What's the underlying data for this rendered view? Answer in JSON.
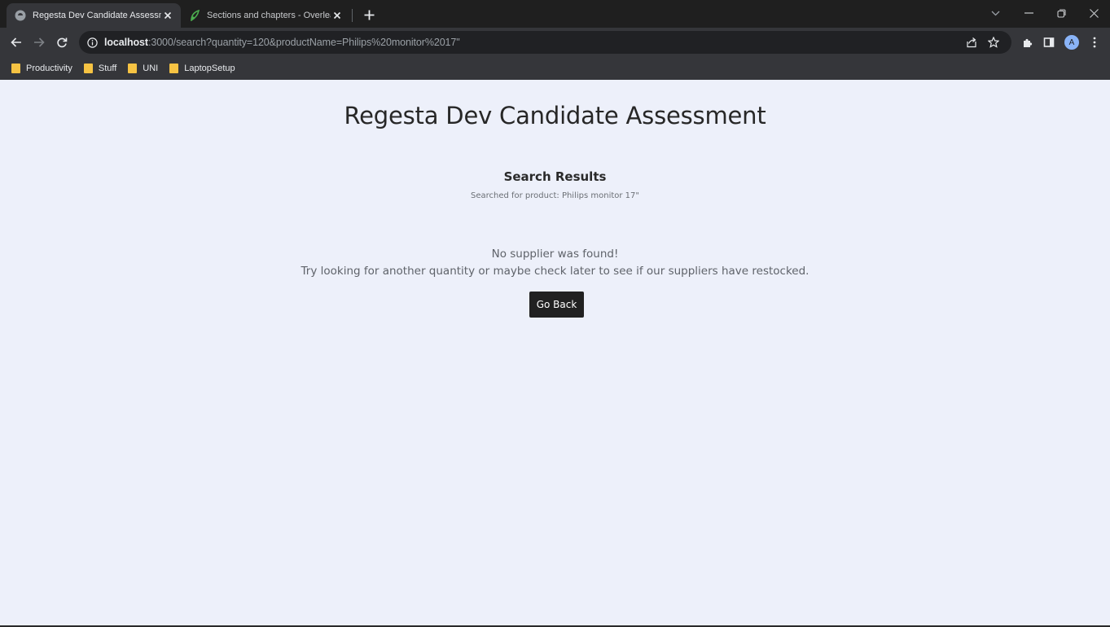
{
  "browser": {
    "tabs": [
      {
        "title": "Regesta Dev Candidate Assessm",
        "favicon": "regesta-app-icon",
        "active": true
      },
      {
        "title": "Sections and chapters - Overleaf",
        "favicon": "overleaf-leaf-icon",
        "active": false
      }
    ],
    "address": {
      "host": "localhost",
      "rest": ":3000/search?quantity=120&productName=Philips%20monitor%2017\""
    },
    "profile_initial": "A",
    "bookmarks": [
      "Productivity",
      "Stuff",
      "UNI",
      "LaptopSetup"
    ]
  },
  "page": {
    "title": "Regesta Dev Candidate Assessment",
    "results_heading": "Search Results",
    "searched_for": "Searched for product: Philips monitor 17\"",
    "message_line1": "No supplier was found!",
    "message_line2": "Try looking for another quantity or maybe check later to see if our suppliers have restocked.",
    "go_back_label": "Go Back"
  },
  "colors": {
    "page_background": "#edf0fa",
    "button_background": "#212121",
    "browser_chrome": "#35363a",
    "bookmark_folder": "#f6c343"
  }
}
